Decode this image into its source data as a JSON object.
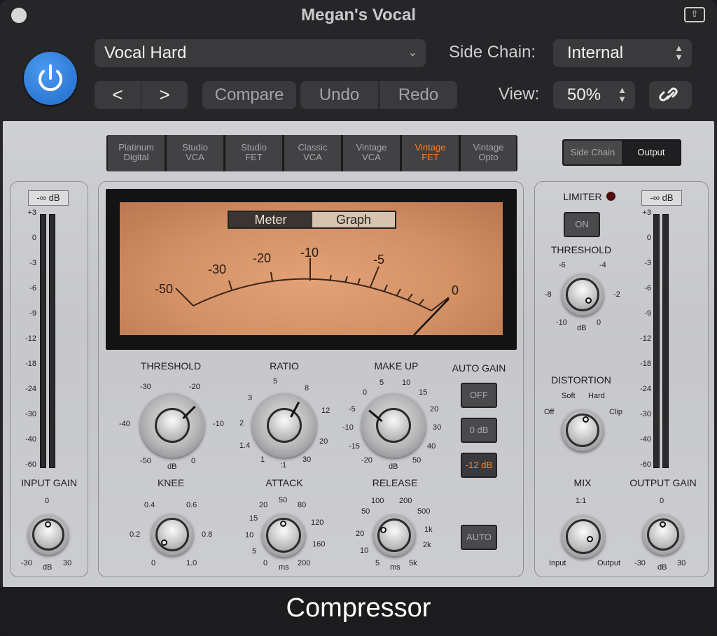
{
  "window": {
    "title": "Megan's Vocal",
    "footer": "Compressor"
  },
  "header": {
    "preset": "Vocal Hard",
    "side_chain_label": "Side Chain:",
    "side_chain_value": "Internal",
    "prev": "<",
    "next": ">",
    "compare": "Compare",
    "undo": "Undo",
    "redo": "Redo",
    "view_label": "View:",
    "view_value": "50%"
  },
  "models": [
    {
      "l1": "Platinum",
      "l2": "Digital"
    },
    {
      "l1": "Studio",
      "l2": "VCA"
    },
    {
      "l1": "Studio",
      "l2": "FET"
    },
    {
      "l1": "Classic",
      "l2": "VCA"
    },
    {
      "l1": "Vintage",
      "l2": "VCA"
    },
    {
      "l1": "Vintage",
      "l2": "FET"
    },
    {
      "l1": "Vintage",
      "l2": "Opto"
    }
  ],
  "selected_model": "Vintage FET",
  "routing": {
    "side_chain": "Side Chain",
    "output": "Output"
  },
  "meter": {
    "tab_meter": "Meter",
    "tab_graph": "Graph",
    "scale": [
      "-50",
      "-30",
      "-20",
      "-10",
      "-5",
      "0"
    ]
  },
  "input": {
    "db_display": "-∞ dB",
    "scale": [
      "+3",
      "0",
      "-3",
      "-6",
      "-9",
      "-12",
      "-18",
      "-24",
      "-30",
      "-40",
      "-60"
    ],
    "gain_label": "INPUT GAIN",
    "gain_ticks": {
      "top": "0",
      "left": "-30",
      "mid": "dB",
      "right": "30"
    }
  },
  "output": {
    "db_display": "-∞ dB",
    "scale": [
      "+3",
      "0",
      "-3",
      "-6",
      "-9",
      "-12",
      "-18",
      "-24",
      "-30",
      "-40",
      "-60"
    ],
    "gain_label": "OUTPUT GAIN",
    "gain_ticks": {
      "top": "0",
      "left": "-30",
      "mid": "dB",
      "right": "30"
    }
  },
  "controls": {
    "threshold": {
      "label": "THRESHOLD",
      "ticks": [
        "-30",
        "-20",
        "-40",
        "-10",
        "-50",
        "dB",
        "0"
      ]
    },
    "ratio": {
      "label": "RATIO",
      "ticks": [
        "5",
        "8",
        "3",
        "12",
        "2",
        "20",
        "1.4",
        "1",
        ":1",
        "30"
      ]
    },
    "makeup": {
      "label": "MAKE UP",
      "ticks": [
        "0",
        "5",
        "10",
        "15",
        "-5",
        "20",
        "-10",
        "30",
        "-15",
        "40",
        "-20",
        "dB",
        "50"
      ]
    },
    "knee": {
      "label": "KNEE",
      "ticks": [
        "0.4",
        "0.6",
        "0.2",
        "0.8",
        "0",
        "1.0"
      ]
    },
    "attack": {
      "label": "ATTACK",
      "ticks": [
        "50",
        "20",
        "80",
        "15",
        "120",
        "10",
        "160",
        "5",
        "0",
        "ms",
        "200"
      ]
    },
    "release": {
      "label": "RELEASE",
      "ticks": [
        "100",
        "200",
        "50",
        "500",
        "20",
        "1k",
        "10",
        "2k",
        "5",
        "ms",
        "5k"
      ]
    }
  },
  "auto_gain": {
    "label": "AUTO GAIN",
    "off": "OFF",
    "zero": "0 dB",
    "minus12": "-12 dB",
    "auto": "AUTO"
  },
  "limiter": {
    "label": "LIMITER",
    "on_button": "ON",
    "threshold_label": "THRESHOLD",
    "threshold_ticks": [
      "-6",
      "-4",
      "-8",
      "-2",
      "-10",
      "dB",
      "0"
    ]
  },
  "distortion": {
    "label": "DISTORTION",
    "ticks": [
      "Soft",
      "Hard",
      "Off",
      "Clip"
    ]
  },
  "mix": {
    "label": "MIX",
    "ticks": [
      "1:1",
      "Input",
      "Output"
    ]
  },
  "colors": {
    "accent": "#ff7f25",
    "power": "#2a78d6",
    "meter_face": "#d8966a"
  }
}
